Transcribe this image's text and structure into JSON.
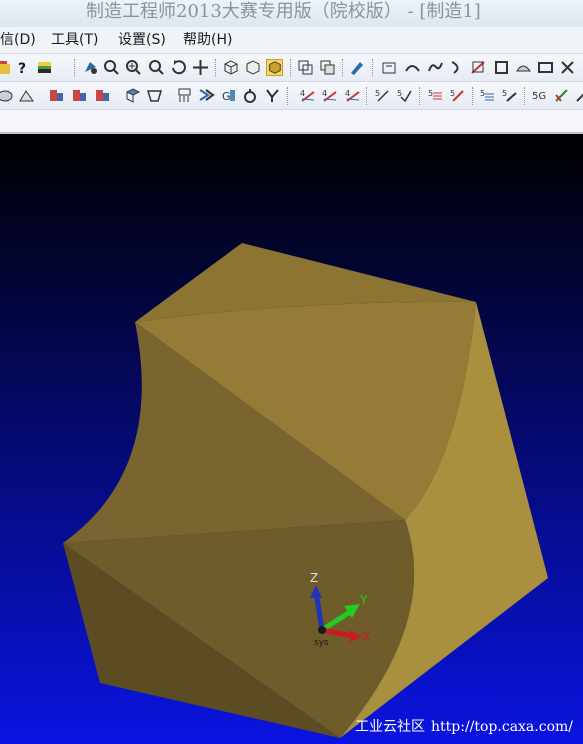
{
  "window": {
    "title": "制造工程师2013大赛专用版（院校版） - [制造1]"
  },
  "menu": {
    "items": [
      {
        "label": "信(D)"
      },
      {
        "label": "工具(T)"
      },
      {
        "label": "设置(S)"
      },
      {
        "label": "帮助(H)"
      }
    ]
  },
  "toolbar_row1": {
    "icons": [
      "help-icon",
      "layer-icon",
      "render-icon",
      "zoom-window-icon",
      "zoom-icon",
      "zoom-dynamic-icon",
      "rotate-icon",
      "pan-icon",
      "wireframe-icon",
      "hidden-line-icon",
      "shaded-icon",
      "view-orient-icon",
      "view-copy-icon",
      "pen-icon",
      "surface-1-icon",
      "surface-2-icon",
      "surface-3-icon",
      "surface-4-icon",
      "surface-5-icon",
      "surface-6-icon",
      "surface-7-icon",
      "surface-8-icon",
      "surface-9-icon"
    ]
  },
  "toolbar_row2": {
    "icons": [
      "solid-1-icon",
      "solid-2-icon",
      "feature-1-icon",
      "feature-2-icon",
      "feature-3-icon",
      "feature-4-icon",
      "feature-5-icon",
      "feature-6-icon",
      "feature-7-icon",
      "feature-8-icon",
      "feature-9-icon",
      "feature-10-icon",
      "machining-1-icon",
      "machining-2-icon",
      "machining-3-icon",
      "machining-4-icon",
      "machining-5-icon",
      "machining-6-icon",
      "machining-7-icon",
      "machining-8-icon",
      "machining-9-icon",
      "machining-10-icon",
      "machining-11-icon"
    ]
  },
  "viewport": {
    "background_top": "#000000",
    "background_bottom": "#0a14e0",
    "solid_color": "#a8903e",
    "triad": {
      "x_label": "X",
      "y_label": "Y",
      "z_label": "Z",
      "origin_label": "sys",
      "x_color": "#cc1a1a",
      "y_color": "#22cc22",
      "z_color": "#2233bb"
    }
  },
  "watermark": {
    "site_name": "工业云社区",
    "url": "http://top.caxa.com/"
  }
}
